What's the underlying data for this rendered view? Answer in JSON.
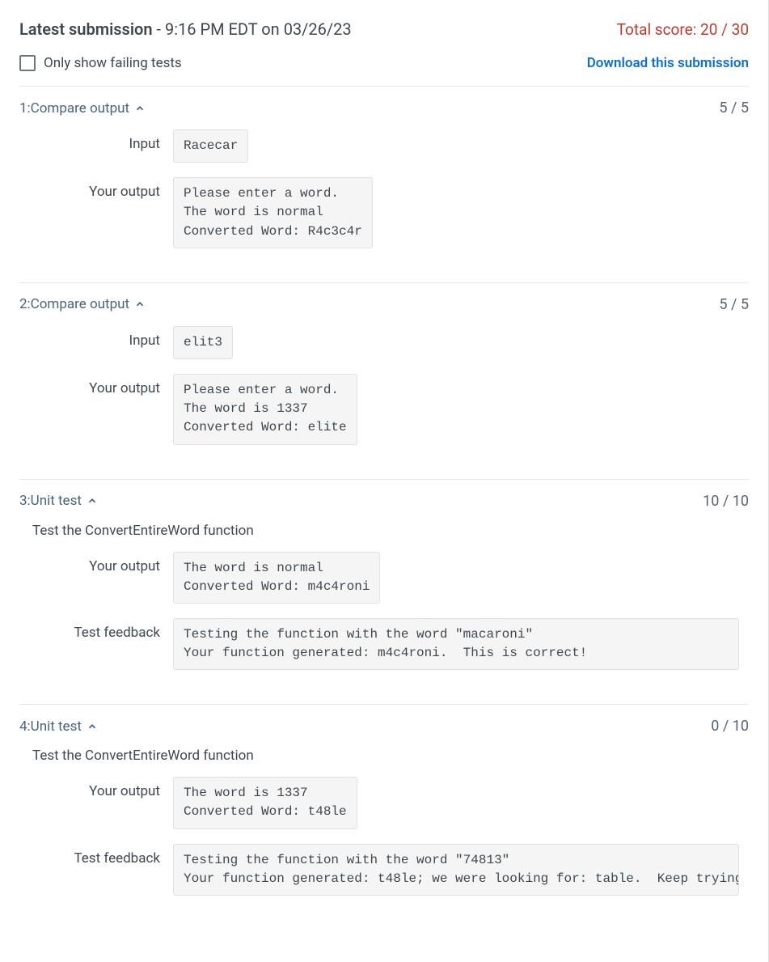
{
  "header": {
    "title_bold": "Latest submission",
    "title_rest": " - 9:16 PM EDT on 03/26/23",
    "total_score": "Total score: 20 / 30"
  },
  "controls": {
    "failing_label": "Only show failing tests",
    "download_label": "Download this submission"
  },
  "labels": {
    "input": "Input",
    "your_output": "Your output",
    "test_feedback": "Test feedback"
  },
  "tests": [
    {
      "title": "1:Compare output",
      "score": "5 / 5",
      "input": "Racecar",
      "output": "Please enter a word.\nThe word is normal\nConverted Word: R4c3c4r"
    },
    {
      "title": "2:Compare output",
      "score": "5 / 5",
      "input": "elit3",
      "output": "Please enter a word.\nThe word is 1337\nConverted Word: elite"
    },
    {
      "title": "3:Unit test",
      "score": "10 / 10",
      "description": "Test the ConvertEntireWord function",
      "output": "The word is normal\nConverted Word: m4c4roni",
      "feedback": "Testing the function with the word \"macaroni\"\nYour function generated: m4c4roni.  This is correct!",
      "feedback_wide": true
    },
    {
      "title": "4:Unit test",
      "score": "0 / 10",
      "description": "Test the ConvertEntireWord function",
      "output": "The word is 1337\nConverted Word: t48le",
      "feedback": "Testing the function with the word \"74813\"\nYour function generated: t48le; we were looking for: table.  Keep trying!",
      "feedback_wide": true
    }
  ]
}
